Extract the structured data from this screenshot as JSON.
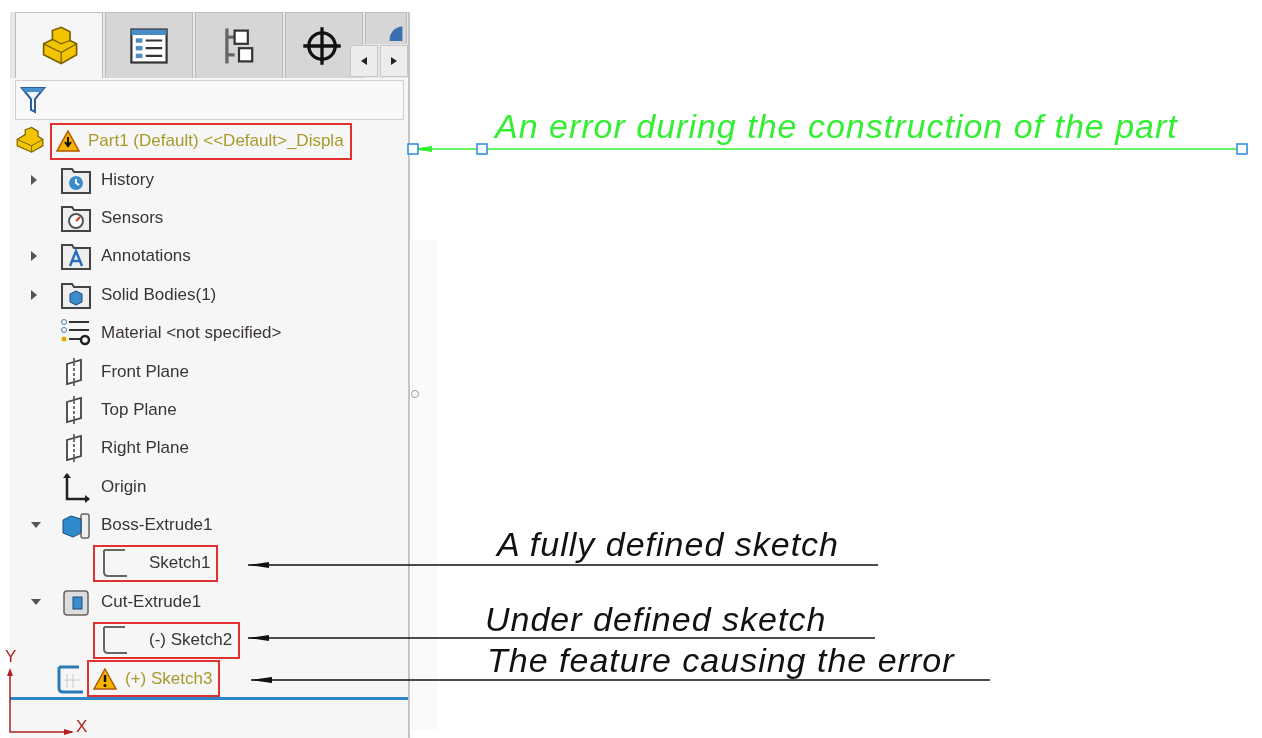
{
  "tabs": [
    {
      "kind": "feature-tree",
      "selected": true
    },
    {
      "kind": "property",
      "selected": false
    },
    {
      "kind": "configuration",
      "selected": false
    },
    {
      "kind": "dimxpert",
      "selected": false
    },
    {
      "kind": "display",
      "selected": false
    }
  ],
  "part": {
    "label": "Part1 (Default) <<Default>_Displa",
    "error": true,
    "highlighted": true
  },
  "features": [
    {
      "kind": "history",
      "label": "History",
      "expanded": false,
      "error": false,
      "highlighted": false
    },
    {
      "kind": "sensors",
      "label": "Sensors",
      "error": false,
      "highlighted": false
    },
    {
      "kind": "annotations",
      "label": "Annotations",
      "expanded": false,
      "error": false,
      "highlighted": false
    },
    {
      "kind": "bodies",
      "label": "Solid Bodies(1)",
      "expanded": false,
      "error": false,
      "highlighted": false
    },
    {
      "kind": "material",
      "label": "Material <not specified>",
      "error": false,
      "highlighted": false
    },
    {
      "kind": "plane",
      "label": "Front Plane",
      "error": false,
      "highlighted": false
    },
    {
      "kind": "plane",
      "label": "Top Plane",
      "error": false,
      "highlighted": false
    },
    {
      "kind": "plane",
      "label": "Right Plane",
      "error": false,
      "highlighted": false
    },
    {
      "kind": "origin",
      "label": "Origin",
      "error": false,
      "highlighted": false
    },
    {
      "kind": "boss",
      "label": "Boss-Extrude1",
      "expanded": true,
      "error": false,
      "highlighted": false,
      "children": [
        {
          "kind": "sketch",
          "label": "Sketch1",
          "error": false,
          "highlighted": true
        }
      ]
    },
    {
      "kind": "cut",
      "label": "Cut-Extrude1",
      "expanded": true,
      "error": false,
      "highlighted": false,
      "children": [
        {
          "kind": "sketch",
          "label": "(-) Sketch2",
          "error": false,
          "highlighted": true
        }
      ]
    },
    {
      "kind": "sketch-grid",
      "label": "(+) Sketch3",
      "error": true,
      "highlighted": true
    }
  ],
  "axes": {
    "y_label": "Y",
    "x_label": "X"
  },
  "callouts": [
    {
      "text": "An error during the construction of the part",
      "color": "#33ee33",
      "selected": true
    },
    {
      "text": "A fully defined sketch",
      "color": "#111111",
      "selected": false
    },
    {
      "text": "Under defined sketch",
      "color": "#111111",
      "selected": false
    },
    {
      "text": "The feature causing the error",
      "color": "#111111",
      "selected": false
    }
  ]
}
